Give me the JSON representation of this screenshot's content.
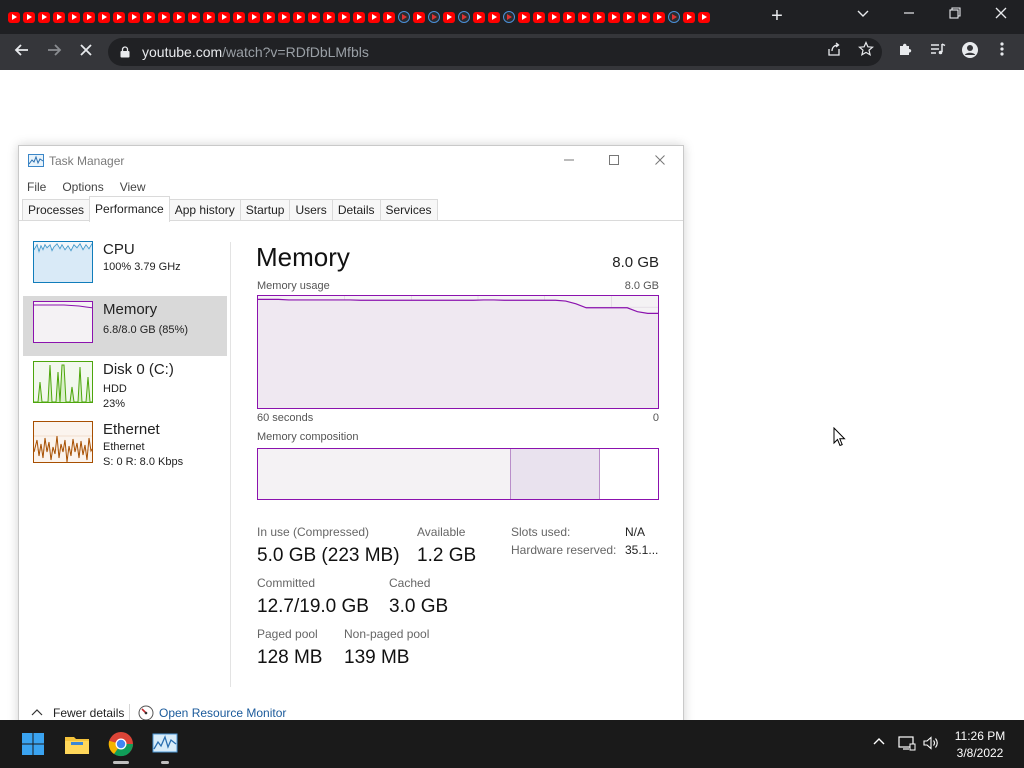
{
  "browser": {
    "tab_icon_pattern": [
      "yt",
      "yt",
      "yt",
      "yt",
      "yt",
      "yt",
      "yt",
      "yt",
      "yt",
      "yt",
      "yt",
      "yt",
      "yt",
      "yt",
      "yt",
      "yt",
      "yt",
      "yt",
      "yt",
      "yt",
      "yt",
      "yt",
      "yt",
      "yt",
      "yt",
      "yt",
      "ring",
      "yt",
      "ring",
      "yt",
      "ring",
      "yt",
      "yt",
      "ring",
      "yt",
      "yt",
      "yt",
      "yt",
      "yt",
      "yt",
      "yt",
      "yt",
      "yt",
      "yt",
      "ring",
      "yt",
      "yt"
    ],
    "new_tab_label": "+",
    "url_domain": "youtube.com",
    "url_path": "/watch?v=RDfDbLMfbls",
    "colors": {
      "tabstrip_bg": "#1f2023",
      "toolbar_bg": "#35363a",
      "youtube_red": "#ff0000"
    }
  },
  "task_manager": {
    "title": "Task Manager",
    "menu": [
      "File",
      "Options",
      "View"
    ],
    "tabs": [
      "Processes",
      "Performance",
      "App history",
      "Startup",
      "Users",
      "Details",
      "Services"
    ],
    "active_tab": "Performance",
    "sidebar": [
      {
        "name": "CPU",
        "line1": "100%  3.79 GHz",
        "line2": "",
        "color": "#117dbb"
      },
      {
        "name": "Memory",
        "line1": "6.8/8.0 GB (85%)",
        "line2": "",
        "color": "#8b12ae"
      },
      {
        "name": "Disk 0 (C:)",
        "line1": "HDD",
        "line2": "23%",
        "color": "#4da60c"
      },
      {
        "name": "Ethernet",
        "line1": "Ethernet",
        "line2": "S: 0  R: 8.0 Kbps",
        "color": "#a74f01"
      }
    ],
    "memory": {
      "heading": "Memory",
      "total": "8.0 GB",
      "usage_label": "Memory usage",
      "usage_max": "8.0 GB",
      "time_left": "60 seconds",
      "time_right": "0",
      "composition_label": "Memory composition",
      "composition": {
        "in_use_fraction": 0.63,
        "modified_fraction": 0.225
      },
      "usage_history": [
        0.97,
        0.97,
        0.97,
        0.965,
        0.965,
        0.965,
        0.965,
        0.965,
        0.965,
        0.965,
        0.962,
        0.962,
        0.962,
        0.962,
        0.962,
        0.962,
        0.962,
        0.962,
        0.962,
        0.962,
        0.962,
        0.962,
        0.965,
        0.965,
        0.962,
        0.962,
        0.962,
        0.962,
        0.962,
        0.962,
        0.955,
        0.93,
        0.895,
        0.895,
        0.895,
        0.895,
        0.895,
        0.86,
        0.845,
        0.845
      ],
      "stats": {
        "in_use_label": "In use (Compressed)",
        "in_use_value": "5.0 GB (223 MB)",
        "available_label": "Available",
        "available_value": "1.2 GB",
        "committed_label": "Committed",
        "committed_value": "12.7/19.0 GB",
        "cached_label": "Cached",
        "cached_value": "3.0 GB",
        "paged_label": "Paged pool",
        "paged_value": "128 MB",
        "nonpaged_label": "Non-paged pool",
        "nonpaged_value": "139 MB",
        "slots_label": "Slots used:",
        "slots_value": "N/A",
        "reserved_label": "Hardware reserved:",
        "reserved_value": "35.1..."
      }
    },
    "footer": {
      "fewer_details": "Fewer details",
      "open_resource_monitor": "Open Resource Monitor"
    }
  },
  "taskbar": {
    "clock_time": "11:26 PM",
    "clock_date": "3/8/2022"
  }
}
